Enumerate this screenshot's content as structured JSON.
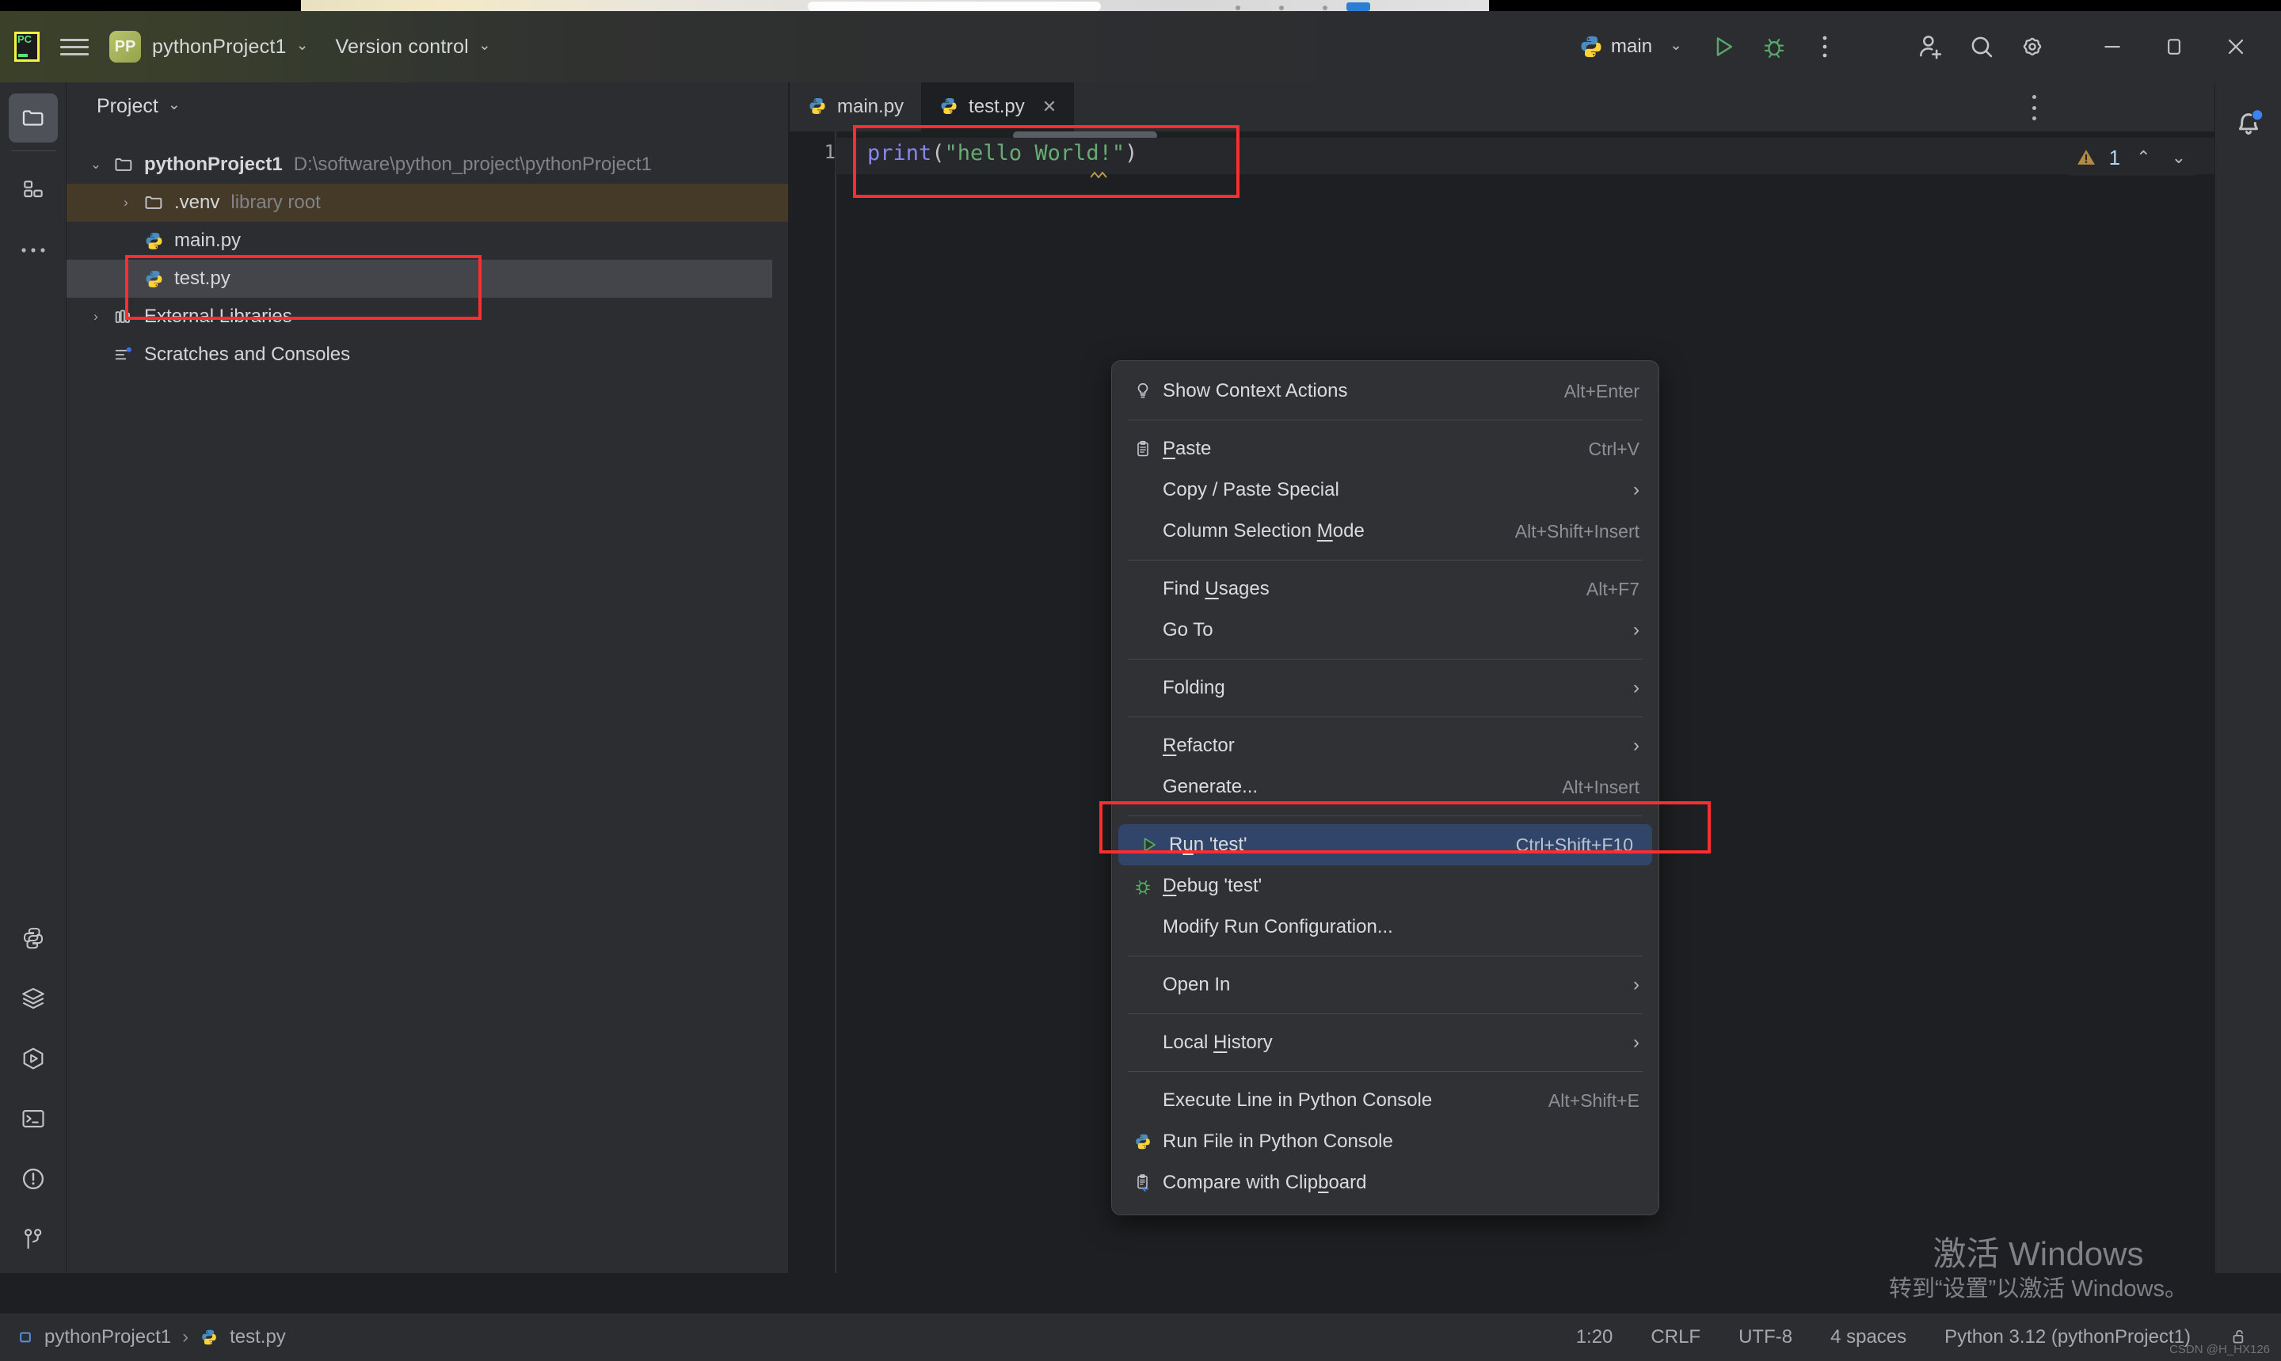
{
  "app": {
    "logo_icon": "pycharm-logo-icon",
    "menu_icon": "hamburger-menu-icon",
    "project_initials": "PP",
    "project_name": "pythonProject1",
    "version_control": "Version control",
    "chevron": "⌄"
  },
  "toolbar": {
    "run_config_name": "main",
    "run_icon": "run-triangle-icon",
    "debug_icon": "debug-bug-icon",
    "more_icon": "more-vertical-icon",
    "add_user_icon": "add-user-icon",
    "search_icon": "search-icon",
    "settings_icon": "gear-icon",
    "minimize_icon": "minimize-icon",
    "maximize_icon": "maximize-restore-icon",
    "close_icon": "close-icon"
  },
  "activity_bar": {
    "top": [
      {
        "name": "project-folder-icon",
        "label": "Project",
        "active": true
      },
      {
        "name": "structure-icon",
        "label": "Structure",
        "active": false
      },
      {
        "name": "more-tool-windows-icon",
        "label": "More tool windows",
        "active": false
      }
    ],
    "bottom": [
      {
        "name": "python-packages-icon",
        "label": "Python Packages"
      },
      {
        "name": "database-layers-icon",
        "label": "Database"
      },
      {
        "name": "run-hexagon-icon",
        "label": "Run"
      },
      {
        "name": "terminal-icon",
        "label": "Terminal"
      },
      {
        "name": "problems-icon",
        "label": "Problems"
      },
      {
        "name": "version-control-branch-icon",
        "label": "Version Control"
      }
    ]
  },
  "project_panel": {
    "title": "Project",
    "title_chevron": "⌄",
    "tree": [
      {
        "indent": 0,
        "arrow": "⌄",
        "icon": "folder-icon",
        "label": "pythonProject1",
        "bold": true,
        "sub": "D:\\software\\python_project\\pythonProject1",
        "state": "root"
      },
      {
        "indent": 1,
        "arrow": "›",
        "icon": "folder-icon",
        "label": ".venv",
        "bold": false,
        "sub": "library root",
        "state": "venv"
      },
      {
        "indent": 1,
        "arrow": "",
        "icon": "python-file-icon",
        "label": "main.py",
        "bold": false,
        "sub": "",
        "state": "normal"
      },
      {
        "indent": 1,
        "arrow": "",
        "icon": "python-file-icon",
        "label": "test.py",
        "bold": false,
        "sub": "",
        "state": "selected"
      },
      {
        "indent": 0,
        "arrow": "›",
        "icon": "external-libraries-icon",
        "label": "External Libraries",
        "bold": false,
        "sub": "",
        "state": "normal"
      },
      {
        "indent": 0,
        "arrow": "",
        "icon": "scratches-icon",
        "label": "Scratches and Consoles",
        "bold": false,
        "sub": "",
        "state": "normal"
      }
    ]
  },
  "editor": {
    "tabs": [
      {
        "label": "main.py",
        "icon": "python-file-icon",
        "active": false,
        "closable": false
      },
      {
        "label": "test.py",
        "icon": "python-file-icon",
        "active": true,
        "closable": true,
        "close_icon": "close-tab-icon"
      }
    ],
    "tab_more_icon": "editor-options-icon",
    "line_number": "1",
    "code_tokens": [
      {
        "text": "print",
        "type": "function"
      },
      {
        "text": "(",
        "type": "paren"
      },
      {
        "text": "\"hello World!\"",
        "type": "string"
      },
      {
        "text": ")",
        "type": "paren"
      }
    ],
    "code_plain": "print(\"hello World!\")",
    "inspection": {
      "warning_icon": "warning-triangle-icon",
      "count": "1",
      "prev_icon": "⌃",
      "next_icon": "⌄"
    }
  },
  "notifications": {
    "bell_icon": "notification-bell-icon",
    "has_badge": true
  },
  "context_menu": {
    "items": [
      {
        "icon": "lightbulb-icon",
        "label": "Show Context Actions",
        "shortcut": "Alt+Enter",
        "submenu": false,
        "mnemonic": "",
        "separator_after": true
      },
      {
        "icon": "paste-clipboard-icon",
        "label": "Paste",
        "shortcut": "Ctrl+V",
        "submenu": false,
        "mnemonic": "P",
        "separator_after": false
      },
      {
        "icon": "",
        "label": "Copy / Paste Special",
        "shortcut": "",
        "submenu": true,
        "mnemonic": "",
        "separator_after": false
      },
      {
        "icon": "",
        "label": "Column Selection Mode",
        "shortcut": "Alt+Shift+Insert",
        "submenu": false,
        "mnemonic": "M",
        "separator_after": true
      },
      {
        "icon": "",
        "label": "Find Usages",
        "shortcut": "Alt+F7",
        "submenu": false,
        "mnemonic": "U",
        "separator_after": false
      },
      {
        "icon": "",
        "label": "Go To",
        "shortcut": "",
        "submenu": true,
        "mnemonic": "",
        "separator_after": true
      },
      {
        "icon": "",
        "label": "Folding",
        "shortcut": "",
        "submenu": true,
        "mnemonic": "",
        "separator_after": true
      },
      {
        "icon": "",
        "label": "Refactor",
        "shortcut": "",
        "submenu": true,
        "mnemonic": "R",
        "separator_after": false
      },
      {
        "icon": "",
        "label": "Generate...",
        "shortcut": "Alt+Insert",
        "submenu": false,
        "mnemonic": "",
        "separator_after": true
      },
      {
        "icon": "run-triangle-icon",
        "label": "Run 'test'",
        "shortcut": "Ctrl+Shift+F10",
        "submenu": false,
        "mnemonic": "u",
        "separator_after": false,
        "highlighted": true
      },
      {
        "icon": "debug-bug-icon",
        "label": "Debug 'test'",
        "shortcut": "",
        "submenu": false,
        "mnemonic": "D",
        "separator_after": false
      },
      {
        "icon": "",
        "label": "Modify Run Configuration...",
        "shortcut": "",
        "submenu": false,
        "mnemonic": "",
        "separator_after": true
      },
      {
        "icon": "",
        "label": "Open In",
        "shortcut": "",
        "submenu": true,
        "mnemonic": "",
        "separator_after": true
      },
      {
        "icon": "",
        "label": "Local History",
        "shortcut": "",
        "submenu": true,
        "mnemonic": "H",
        "separator_after": true
      },
      {
        "icon": "",
        "label": "Execute Line in Python Console",
        "shortcut": "Alt+Shift+E",
        "submenu": false,
        "mnemonic": "",
        "separator_after": false
      },
      {
        "icon": "python-file-icon",
        "label": "Run File in Python Console",
        "shortcut": "",
        "submenu": false,
        "mnemonic": "",
        "separator_after": false
      },
      {
        "icon": "compare-clipboard-icon",
        "label": "Compare with Clipboard",
        "shortcut": "",
        "submenu": false,
        "mnemonic": "b",
        "separator_after": false
      }
    ]
  },
  "annotations": {
    "color": "#ff2d2d",
    "boxes": [
      {
        "name": "code-line-highlight"
      },
      {
        "name": "test-py-tree-item-highlight"
      },
      {
        "name": "run-test-menu-item-highlight"
      }
    ]
  },
  "watermark": {
    "line1": "激活 Windows",
    "line2": "转到“设置”以激活 Windows。"
  },
  "status_bar": {
    "breadcrumb": [
      {
        "icon": "module-icon",
        "label": "pythonProject1"
      },
      {
        "icon": "python-file-icon",
        "label": "test.py"
      }
    ],
    "separator": "›",
    "caret_position": "1:20",
    "line_separator": "CRLF",
    "encoding": "UTF-8",
    "indent": "4 spaces",
    "interpreter": "Python 3.12 (pythonProject1)",
    "lock_icon": "unlocked-icon",
    "watermark_credit": "CSDN @H_HX126"
  }
}
